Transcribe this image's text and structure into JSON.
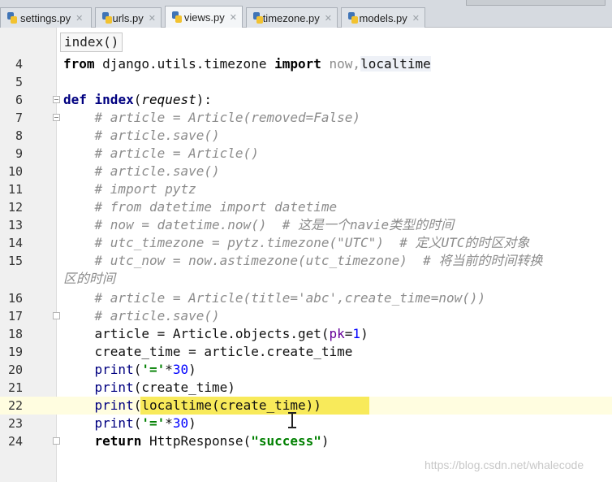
{
  "tabs": [
    {
      "label": "settings.py",
      "active": false
    },
    {
      "label": "urls.py",
      "active": false
    },
    {
      "label": "views.py",
      "active": true
    },
    {
      "label": "timezone.py",
      "active": false
    },
    {
      "label": "models.py",
      "active": false
    }
  ],
  "breadcrumb": "index()",
  "lines": {
    "l4": "4",
    "l5": "5",
    "l6": "6",
    "l7": "7",
    "l8": "8",
    "l9": "9",
    "l10": "10",
    "l11": "11",
    "l12": "12",
    "l13": "13",
    "l14": "14",
    "l15": "15",
    "l16": "16",
    "l17": "17",
    "l18": "18",
    "l19": "19",
    "l20": "20",
    "l21": "21",
    "l22": "22",
    "l23": "23",
    "l24": "24"
  },
  "code": {
    "c4_from": "from",
    "c4_mod": " django.utils.timezone ",
    "c4_import": "import",
    "c4_names": " now,",
    "c4_local": "localtime",
    "c6_def": "def",
    "c6_name": " index",
    "c6_open": "(",
    "c6_param": "request",
    "c6_close": "):",
    "c7": "    # article = Article(removed=False)",
    "c8": "    # article.save()",
    "c9": "    # article = Article()",
    "c10": "    # article.save()",
    "c11": "    # import pytz",
    "c12": "    # from datetime import datetime",
    "c13": "    # now = datetime.now()  # 这是一个navie类型的时间",
    "c14": "    # utc_timezone = pytz.timezone(\"UTC\")  # 定义UTC的时区对象",
    "c15": "    # utc_now = now.astimezone(utc_timezone)  # 将当前的时间转换",
    "c15_wrap": "区的时间",
    "c16": "    # article = Article(title='abc',create_time=now())",
    "c17": "    # article.save()",
    "c18_a": "    article = Article.objects.get(",
    "c18_pk": "pk",
    "c18_eq": "=",
    "c18_num": "1",
    "c18_close": ")",
    "c19": "    create_time = article.create_time",
    "c20_print": "    print",
    "c20_open": "(",
    "c20_str": "'='",
    "c20_mul": "*",
    "c20_num": "30",
    "c20_close": ")",
    "c21_print": "    print",
    "c21_rest": "(create_time)",
    "c22_print": "    print",
    "c22_rest": "(localtime(create_time))",
    "c23_print": "    print",
    "c23_open": "(",
    "c23_str": "'='",
    "c23_mul": "*",
    "c23_num": "30",
    "c23_close": ")",
    "c24_return": "    return",
    "c24_mid": " HttpResponse(",
    "c24_str": "\"success\"",
    "c24_close": ")"
  },
  "watermark": "https://blog.csdn.net/whalecode",
  "colors": {
    "keyword": "#000080",
    "comment": "#8c8c8c",
    "string": "#008000",
    "number": "#0000ff",
    "highlight": "#f8ea5a"
  }
}
